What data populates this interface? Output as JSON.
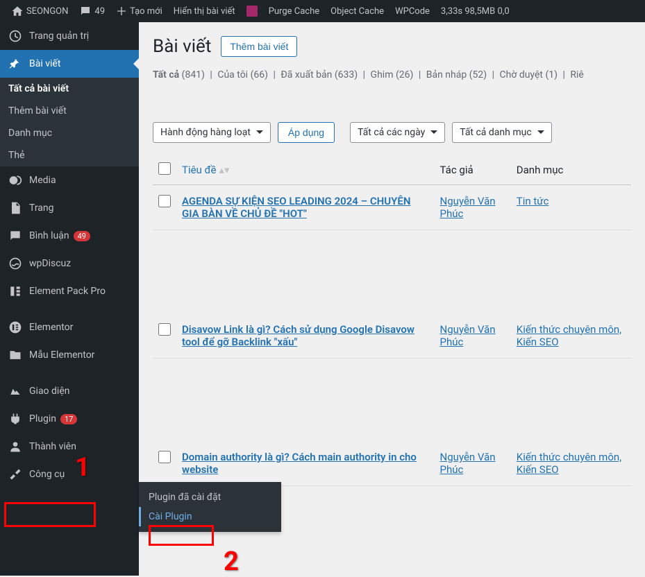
{
  "adminBar": {
    "siteName": "SEONGON",
    "commentCount": "49",
    "newLabel": "Tạo mới",
    "viewPost": "Hiển thị bài viết",
    "purgeCache": "Purge Cache",
    "objectCache": "Object Cache",
    "wpcode": "WPCode",
    "perf": "3,33s 98,5MB 0,0"
  },
  "sidebar": {
    "dashboard": "Trang quản trị",
    "posts": "Bài viết",
    "postsSubmenu": {
      "all": "Tất cả bài viết",
      "add": "Thêm bài viết",
      "categories": "Danh mục",
      "tags": "Thẻ"
    },
    "media": "Media",
    "pages": "Trang",
    "comments": "Bình luận",
    "commentsCount": "49",
    "wpdiscuz": "wpDiscuz",
    "elementPack": "Element Pack Pro",
    "elementor": "Elementor",
    "elementorTemplates": "Mẫu Elementor",
    "appearance": "Giao diện",
    "plugins": "Plugin",
    "pluginsCount": "17",
    "users": "Thành viên",
    "tools": "Công cụ"
  },
  "flyout": {
    "installed": "Plugin đã cài đặt",
    "addNew": "Cài Plugin"
  },
  "annotations": {
    "one": "1",
    "two": "2"
  },
  "page": {
    "title": "Bài viết",
    "addNew": "Thêm bài viết"
  },
  "filters": {
    "all": "Tất cả",
    "allCount": "(841)",
    "mine": "Của tôi",
    "mineCount": "(66)",
    "published": "Đã xuất bản",
    "publishedCount": "(633)",
    "sticky": "Ghim",
    "stickyCount": "(26)",
    "draft": "Bản nháp",
    "draftCount": "(52)",
    "pending": "Chờ duyệt",
    "pendingCount": "(1)",
    "more": "Riê"
  },
  "tablenav": {
    "bulk": "Hành động hàng loạt",
    "apply": "Áp dụng",
    "dates": "Tất cả các ngày",
    "cats": "Tất cả danh mục"
  },
  "table": {
    "cols": {
      "title": "Tiêu đề",
      "author": "Tác giả",
      "category": "Danh mục"
    },
    "rows": [
      {
        "title": "AGENDA SỰ KIỆN SEO LEADING 2024 – CHUYÊN GIA BÀN VỀ CHỦ ĐỀ \"HOT\"",
        "author": "Nguyễn Văn Phúc",
        "category": "Tin tức"
      },
      {
        "title": "Disavow Link là gì? Cách sử dụng Google Disavow tool để gỡ Backlink \"xấu\"",
        "author": "Nguyễn Văn Phúc",
        "category": "Kiến thức chuyên môn, Kiến SEO"
      },
      {
        "title": "Domain authority là gì? Cách main authority in cho website",
        "author": "Nguyễn Văn Phúc",
        "category": "Kiến thức chuyên môn, Kiến SEO"
      }
    ]
  }
}
